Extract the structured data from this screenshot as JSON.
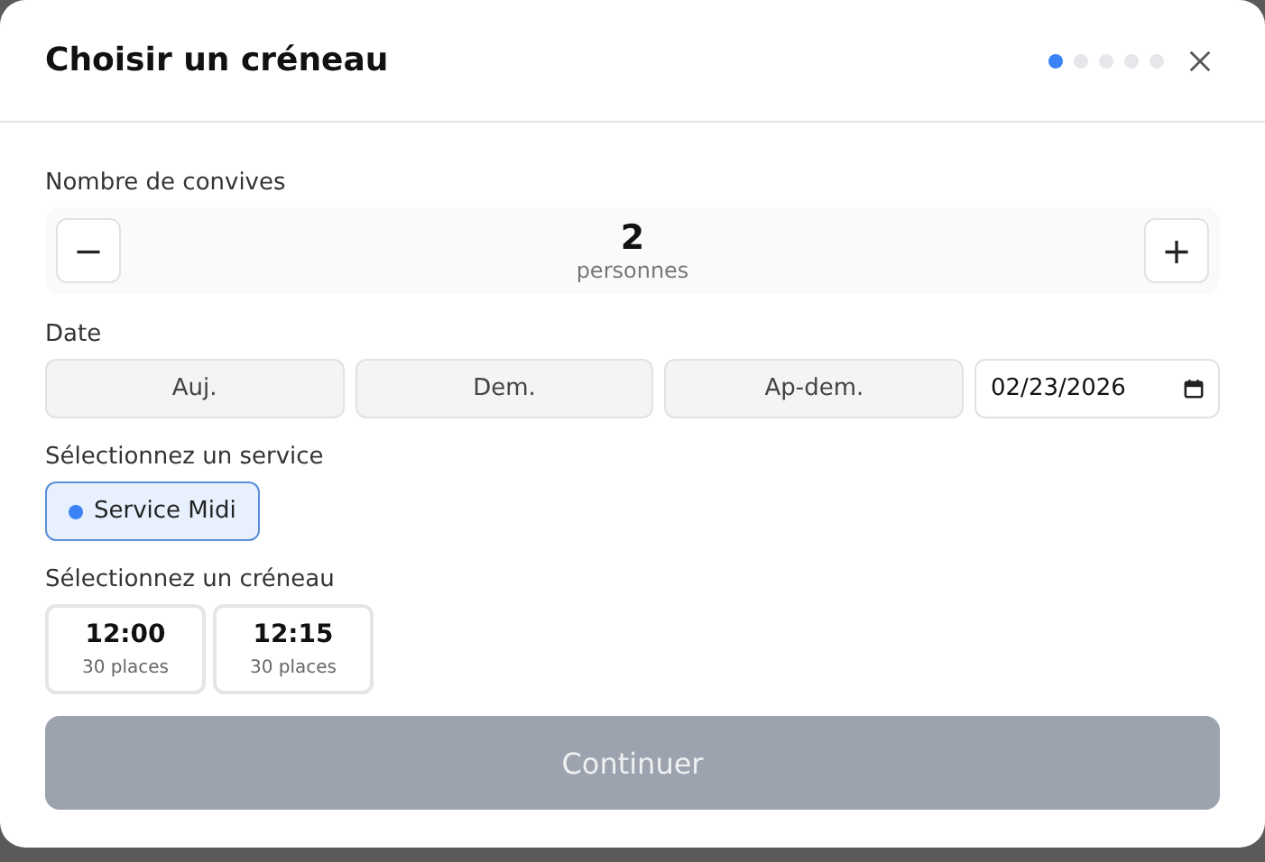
{
  "dialog": {
    "title": "Choisir un créneau",
    "steps": [
      {
        "selected": true
      },
      {
        "selected": false
      },
      {
        "selected": false
      },
      {
        "selected": false
      },
      {
        "selected": false
      }
    ]
  },
  "guests": {
    "label": "Nombre de convives",
    "minus": "−",
    "value": "2",
    "unit": "personnes",
    "plus": "+"
  },
  "date": {
    "label": "Date",
    "options": [
      {
        "label": "Auj.",
        "selected": false
      },
      {
        "label": "Dem.",
        "selected": false
      },
      {
        "label": "Ap-dem.",
        "selected": false
      }
    ],
    "value": "02/23/2026"
  },
  "service": {
    "label": "Sélectionnez un service",
    "options": [
      {
        "label": "Service Midi",
        "selected": true,
        "color": "#3b82f6"
      }
    ]
  },
  "slots": {
    "label": "Sélectionnez un créneau",
    "items": [
      {
        "time": "12:00",
        "places": "30 places",
        "selected": false
      },
      {
        "time": "12:15",
        "places": "30 places",
        "selected": false
      }
    ]
  },
  "continue": {
    "label": "Continuer",
    "disabled": true
  }
}
